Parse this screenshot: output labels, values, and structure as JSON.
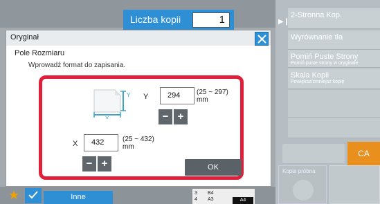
{
  "header": {
    "copies_label": "Liczba kopii",
    "copies_value": "1"
  },
  "right_panel": {
    "items": [
      {
        "title": "2-Stronna Kop.",
        "subtitle": ""
      },
      {
        "title": "Wyrównanie tła",
        "subtitle": ""
      },
      {
        "title": "Pomiń Puste Strony",
        "subtitle": "Pomiń puste strony w oryginale"
      },
      {
        "title": "Skala Kopii",
        "subtitle": "Powiększ/zmniejsz kopię"
      }
    ],
    "ca_label": "CA",
    "kopia_label": "Kopia próbna"
  },
  "bottom_bar": {
    "inne_label": "Inne",
    "trays": [
      {
        "num": "3",
        "size": "B4"
      },
      {
        "num": "4",
        "size": "A3"
      }
    ],
    "selected_tray": "A4"
  },
  "dialog": {
    "title": "Oryginał",
    "subtitle": "Pole Rozmiaru",
    "instruction": "Wprowadź format do zapisania.",
    "icon_y_label": "Y",
    "icon_x_label": "X",
    "y": {
      "label": "Y",
      "value": "294",
      "range": "(25 ~ 297)",
      "unit": "mm"
    },
    "x": {
      "label": "X",
      "value": "432",
      "range": "(25 ~ 432)",
      "unit": "mm"
    },
    "minus_label": "−",
    "plus_label": "+",
    "ok_label": "OK"
  },
  "colors": {
    "accent_blue": "#2e8fd4",
    "frame_red": "#e0203a",
    "ca_orange": "#e88f1d"
  }
}
